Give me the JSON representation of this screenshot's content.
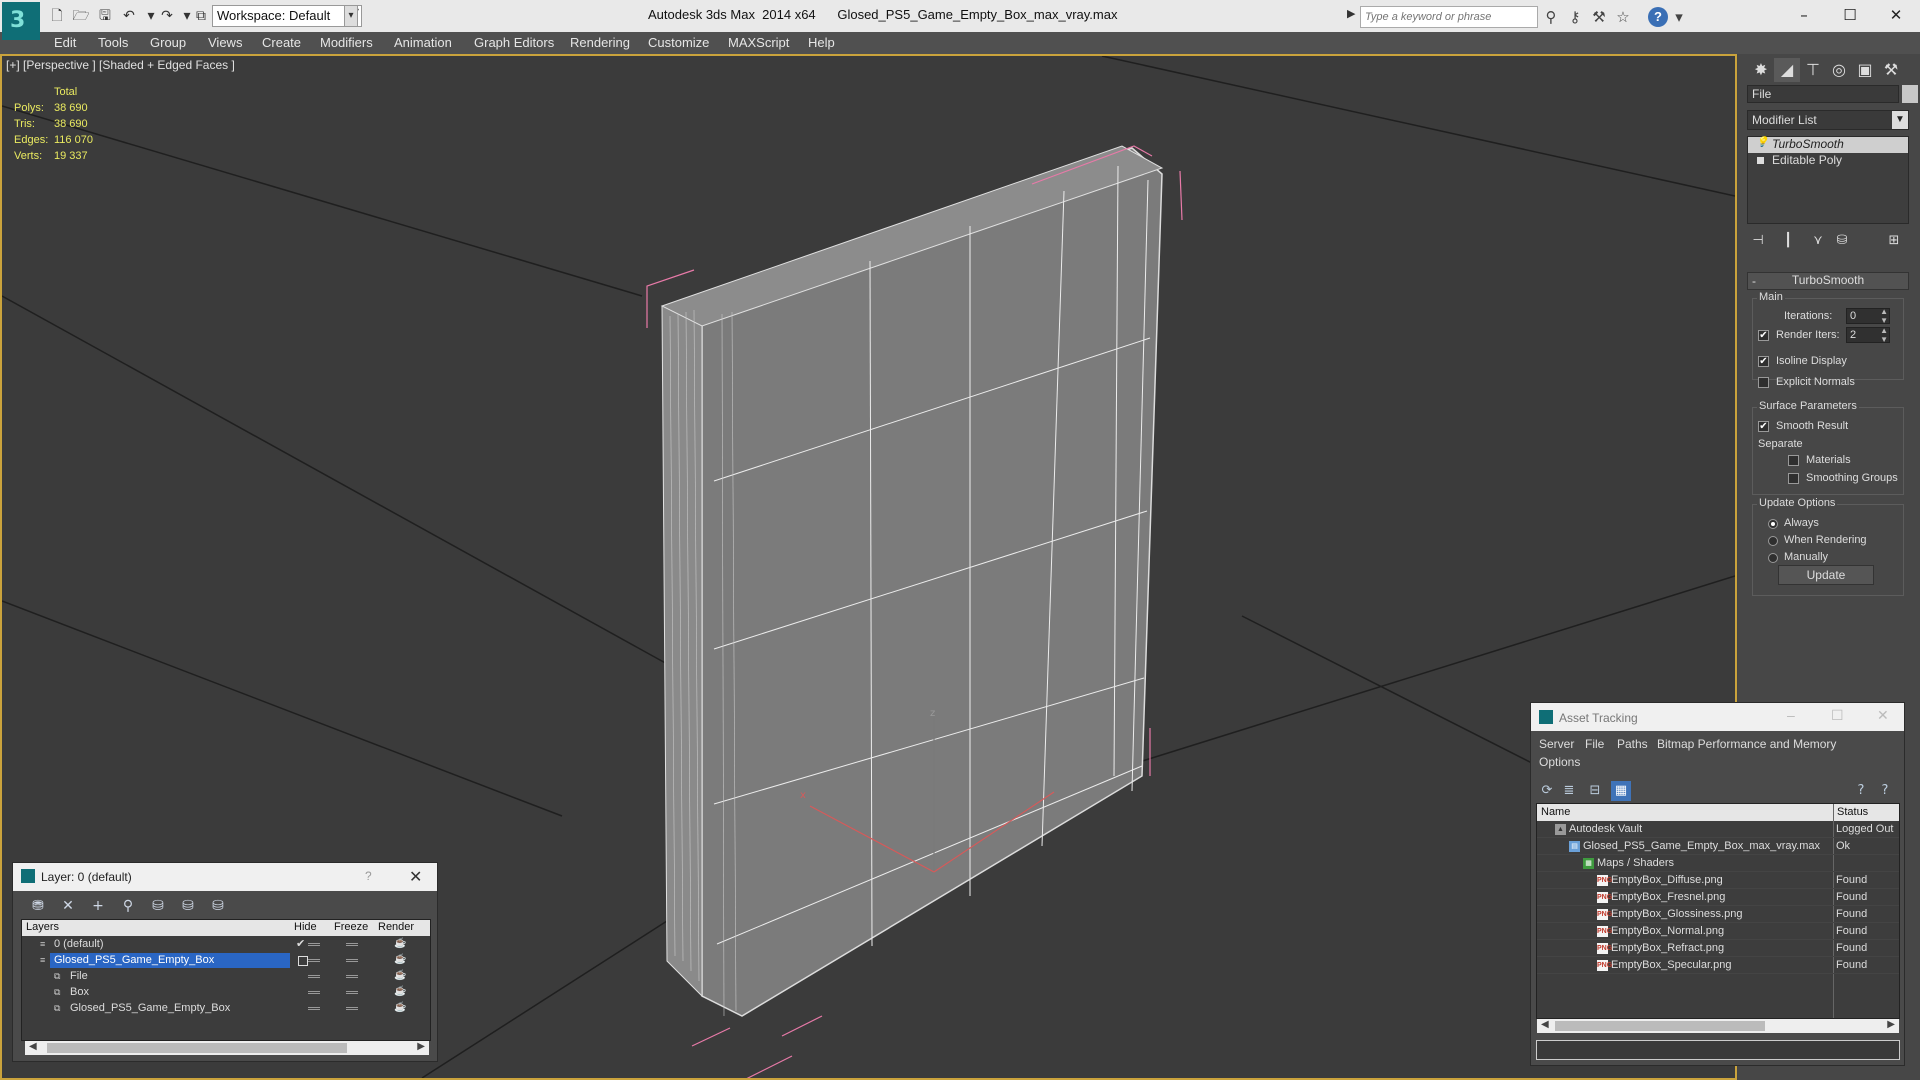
{
  "window": {
    "app": "Autodesk 3ds Max  2014 x64",
    "file": "Glosed_PS5_Game_Empty_Box_max_vray.max",
    "workspace": "Workspace: Default",
    "search_placeholder": "Type a keyword or phrase"
  },
  "menu": [
    "Edit",
    "Tools",
    "Group",
    "Views",
    "Create",
    "Modifiers",
    "Animation",
    "Graph Editors",
    "Rendering",
    "Customize",
    "MAXScript",
    "Help"
  ],
  "viewport": {
    "label": "[+] [Perspective ] [Shaded + Edged Faces ]",
    "stats": {
      "header": "Total",
      "rows": [
        {
          "k": "Polys:",
          "v": "38 690"
        },
        {
          "k": "Tris:",
          "v": "38 690"
        },
        {
          "k": "Edges:",
          "v": "116 070"
        },
        {
          "k": "Verts:",
          "v": "19 337"
        }
      ]
    }
  },
  "command_panel": {
    "name_field": "File",
    "modifier_list": "Modifier List",
    "stack": [
      "TurboSmooth",
      "Editable Poly"
    ],
    "rollout": "TurboSmooth",
    "main_group": "Main",
    "iterations_label": "Iterations:",
    "iterations_value": "0",
    "render_iters_label": "Render Iters:",
    "render_iters_value": "2",
    "render_iters_checked": true,
    "isoline_label": "Isoline Display",
    "isoline_checked": true,
    "explicit_normals_label": "Explicit Normals",
    "explicit_normals_checked": false,
    "surface_params": "Surface Parameters",
    "smooth_result_label": "Smooth Result",
    "smooth_result_checked": true,
    "separate_label": "Separate",
    "materials_label": "Materials",
    "smoothing_groups_label": "Smoothing Groups",
    "update_options": "Update Options",
    "always_label": "Always",
    "when_rendering_label": "When Rendering",
    "manually_label": "Manually",
    "update_selected": "Always",
    "update_button": "Update"
  },
  "layer_dialog": {
    "title": "Layer: 0 (default)",
    "help": "?",
    "columns": [
      "Layers",
      "Hide",
      "Freeze",
      "Render"
    ],
    "rows": [
      {
        "name": "0 (default)",
        "indent": 1,
        "current": true,
        "selected": false
      },
      {
        "name": "Glosed_PS5_Game_Empty_Box",
        "indent": 1,
        "current": false,
        "selected": true
      },
      {
        "name": "File",
        "indent": 2,
        "current": false,
        "selected": false
      },
      {
        "name": "Box",
        "indent": 2,
        "current": false,
        "selected": false
      },
      {
        "name": "Glosed_PS5_Game_Empty_Box",
        "indent": 2,
        "current": false,
        "selected": false
      }
    ]
  },
  "asset_tracking": {
    "title": "Asset Tracking",
    "menu_row1": [
      "Server",
      "File",
      "Paths",
      "Bitmap Performance and Memory"
    ],
    "menu_row2": [
      "Options"
    ],
    "columns": [
      "Name",
      "Status"
    ],
    "rows": [
      {
        "name": "Autodesk Vault",
        "status": "Logged Out",
        "icon": "vault",
        "level": 0
      },
      {
        "name": "Glosed_PS5_Game_Empty_Box_max_vray.max",
        "status": "Ok",
        "icon": "max",
        "level": 1
      },
      {
        "name": "Maps / Shaders",
        "status": "",
        "icon": "maps",
        "level": 2
      },
      {
        "name": "EmptyBox_Diffuse.png",
        "status": "Found",
        "icon": "png",
        "level": 3
      },
      {
        "name": "EmptyBox_Fresnel.png",
        "status": "Found",
        "icon": "png",
        "level": 3
      },
      {
        "name": "EmptyBox_Glossiness.png",
        "status": "Found",
        "icon": "png",
        "level": 3
      },
      {
        "name": "EmptyBox_Normal.png",
        "status": "Found",
        "icon": "png",
        "level": 3
      },
      {
        "name": "EmptyBox_Refract.png",
        "status": "Found",
        "icon": "png",
        "level": 3
      },
      {
        "name": "EmptyBox_Specular.png",
        "status": "Found",
        "icon": "png",
        "level": 3
      }
    ]
  },
  "colors": {
    "viewport_bg": "#3b3b3b",
    "active_border": "#caa33c",
    "stats_text": "#eaea60",
    "selection": "#2a66c4",
    "bbox": "#e87aa8"
  }
}
